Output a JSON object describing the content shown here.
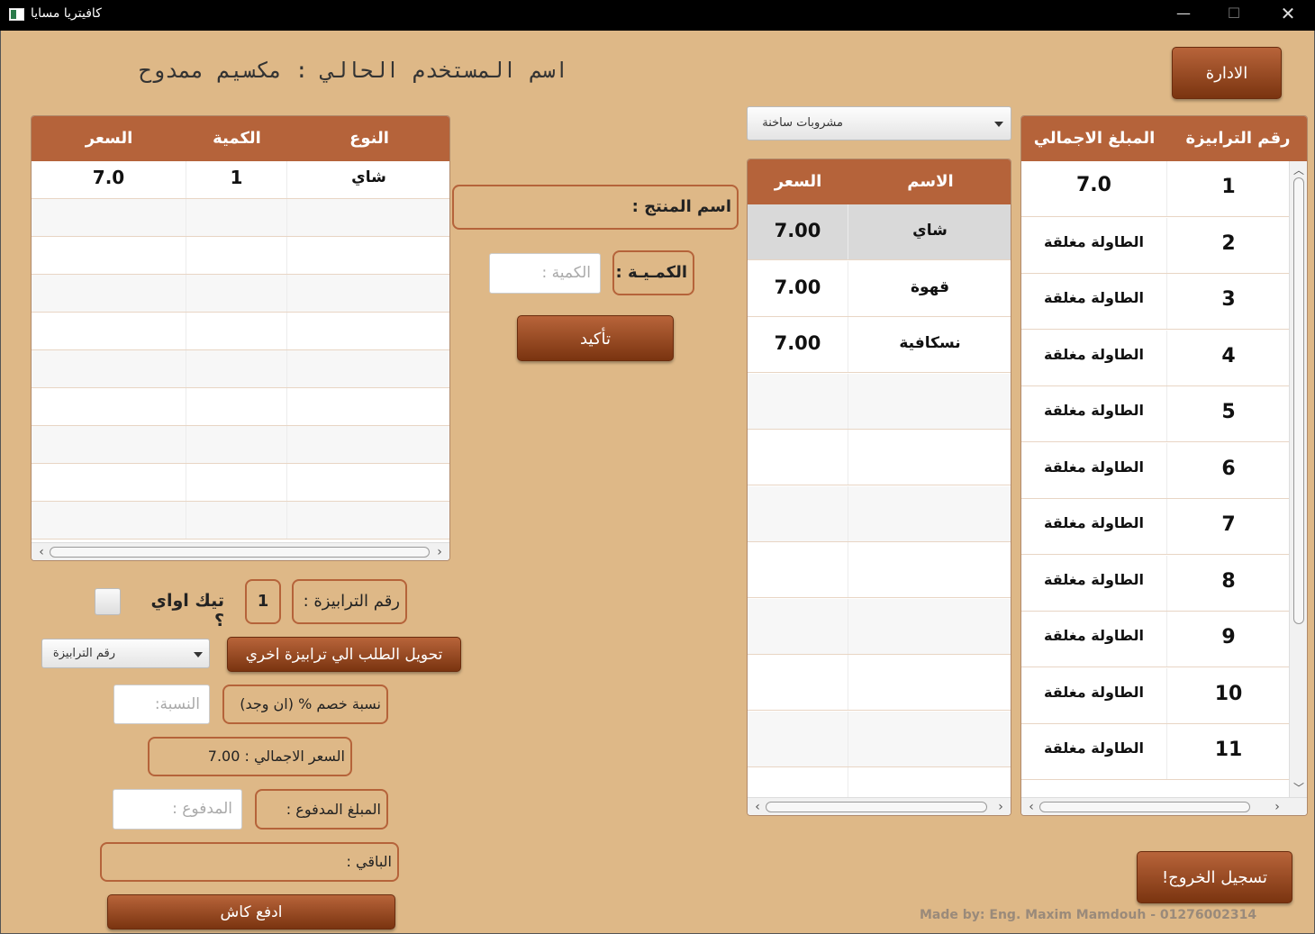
{
  "window": {
    "title": "كافيتريا مسايا",
    "min_glyph": "—",
    "max_glyph": "☐",
    "close_glyph": "✕"
  },
  "header": {
    "admin_button": "الادارة",
    "current_user": "اسم المستخدم الحالي : مكسيم ممدوح"
  },
  "order_table": {
    "columns": [
      "النوع",
      "الكمية",
      "السعر"
    ],
    "rows": [
      {
        "type": "شاي",
        "qty": "1",
        "price": "7.0"
      }
    ]
  },
  "product_form": {
    "product_name_label": "اسم المنتج :",
    "quantity_label": "الكمـيـة :",
    "quantity_placeholder": "الكمية :",
    "confirm_button": "تأكيد"
  },
  "category_select": {
    "selected": "مشروبات ساخنة"
  },
  "products_table": {
    "columns": [
      "الاسم",
      "السعر"
    ],
    "rows": [
      {
        "name": "شاي",
        "price": "7.00"
      },
      {
        "name": "قهوة",
        "price": "7.00"
      },
      {
        "name": "نسكافية",
        "price": "7.00"
      }
    ]
  },
  "tables_table": {
    "columns": [
      "رقم الترابيزة",
      "المبلغ الاجمالي"
    ],
    "rows": [
      {
        "num": "1",
        "total": "7.0"
      },
      {
        "num": "2",
        "total": "الطاولة مغلقة"
      },
      {
        "num": "3",
        "total": "الطاولة مغلقة"
      },
      {
        "num": "4",
        "total": "الطاولة مغلقة"
      },
      {
        "num": "5",
        "total": "الطاولة مغلقة"
      },
      {
        "num": "6",
        "total": "الطاولة مغلقة"
      },
      {
        "num": "7",
        "total": "الطاولة مغلقة"
      },
      {
        "num": "8",
        "total": "الطاولة مغلقة"
      },
      {
        "num": "9",
        "total": "الطاولة مغلقة"
      },
      {
        "num": "10",
        "total": "الطاولة مغلقة"
      },
      {
        "num": "11",
        "total": "الطاولة مغلقة"
      }
    ]
  },
  "checkout": {
    "table_number_label": "رقم الترابيزة :",
    "table_number_value": "1",
    "takeaway_label": "تيك اواي ؟",
    "takeaway_checked": false,
    "transfer_button": "تحويل الطلب الي ترابيزة اخري",
    "transfer_select_placeholder": "رقم الترابيزة",
    "discount_label": "نسبة خصم % (ان وجد)",
    "discount_placeholder": "النسبة:",
    "total_label": "السعر الاجمالي : 7.00",
    "paid_label": "المبلغ المدفوع :",
    "paid_placeholder": "المدفوع :",
    "remaining_label": "الباقي :",
    "pay_cash_button": "ادفع كاش"
  },
  "footer": {
    "logout_button": "تسجيل الخروج!",
    "credit": "Made by: Eng. Maxim Mamdouh - 01276002314"
  },
  "colors": {
    "background": "#deb887",
    "header_brown": "#b5633a",
    "button_dark": "#7a3410"
  },
  "icons": [
    "app-icon",
    "minimize-icon",
    "maximize-icon",
    "close-icon",
    "chevron-down-icon",
    "chevron-left-icon",
    "chevron-right-icon",
    "chevron-up-icon"
  ]
}
